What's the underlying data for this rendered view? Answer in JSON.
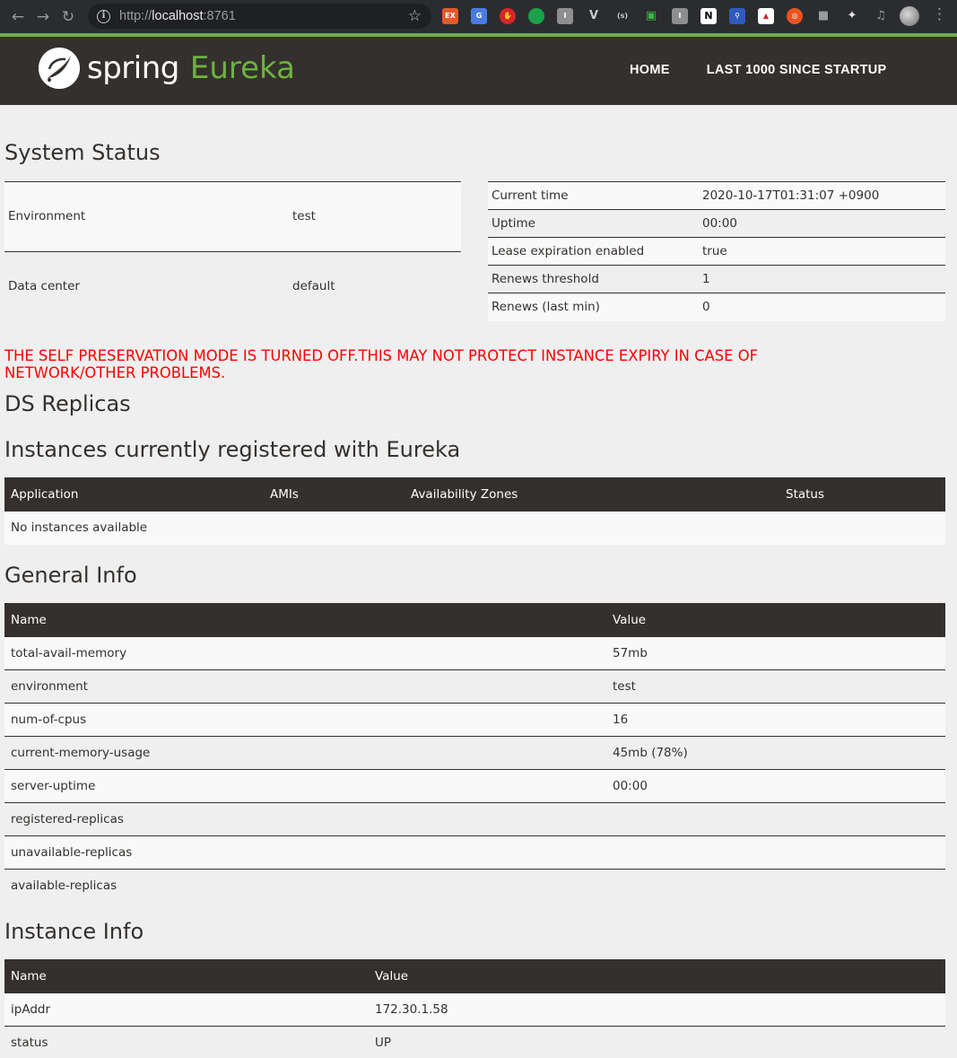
{
  "browser": {
    "url_scheme": "http://",
    "url_host": "localhost",
    "url_port": ":8761",
    "extensions": [
      "ex-icon",
      "translate-icon",
      "adblock-icon",
      "evernote-icon",
      "reader-icon",
      "vivaldi-icon",
      "sigma-icon",
      "crop-icon",
      "instapaper-icon",
      "notion-icon",
      "zoom-icon",
      "colorzilla-icon",
      "ubuntu-icon",
      "cube-icon",
      "puzzle-icon",
      "media-icon"
    ]
  },
  "navbar": {
    "brand_spring": "spring",
    "brand_eureka": "Eureka",
    "links": [
      "HOME",
      "LAST 1000 SINCE STARTUP"
    ]
  },
  "system_status": {
    "title": "System Status",
    "left": [
      {
        "key": "Environment",
        "value": "test"
      },
      {
        "key": "Data center",
        "value": "default"
      }
    ],
    "right": [
      {
        "key": "Current time",
        "value": "2020-10-17T01:31:07 +0900"
      },
      {
        "key": "Uptime",
        "value": "00:00"
      },
      {
        "key": "Lease expiration enabled",
        "value": "true"
      },
      {
        "key": "Renews threshold",
        "value": "1"
      },
      {
        "key": "Renews (last min)",
        "value": "0"
      }
    ]
  },
  "warning": {
    "line1": "THE SELF PRESERVATION MODE IS TURNED OFF.THIS MAY NOT PROTECT INSTANCE EXPIRY IN CASE OF",
    "line2": "NETWORK/OTHER PROBLEMS."
  },
  "ds_replicas": {
    "title": "DS Replicas"
  },
  "instances": {
    "title": "Instances currently registered with Eureka",
    "headers": [
      "Application",
      "AMIs",
      "Availability Zones",
      "Status"
    ],
    "empty_text": "No instances available"
  },
  "general_info": {
    "title": "General Info",
    "headers": [
      "Name",
      "Value"
    ],
    "rows": [
      {
        "name": "total-avail-memory",
        "value": "57mb"
      },
      {
        "name": "environment",
        "value": "test"
      },
      {
        "name": "num-of-cpus",
        "value": "16"
      },
      {
        "name": "current-memory-usage",
        "value": "45mb (78%)"
      },
      {
        "name": "server-uptime",
        "value": "00:00"
      },
      {
        "name": "registered-replicas",
        "value": ""
      },
      {
        "name": "unavailable-replicas",
        "value": ""
      },
      {
        "name": "available-replicas",
        "value": ""
      }
    ]
  },
  "instance_info": {
    "title": "Instance Info",
    "headers": [
      "Name",
      "Value"
    ],
    "rows": [
      {
        "name": "ipAddr",
        "value": "172.30.1.58"
      },
      {
        "name": "status",
        "value": "UP"
      }
    ]
  },
  "colors": {
    "navbar_bg": "#34302d",
    "spring_green": "#6db33f",
    "warning_red": "#ff0000",
    "page_bg": "#efefef"
  }
}
